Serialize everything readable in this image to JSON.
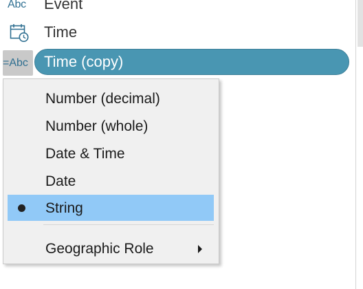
{
  "fields": [
    {
      "icon": "string-type-icon",
      "icon_text": "Abc",
      "label": "Event"
    },
    {
      "icon": "date-time-type-icon",
      "label": "Time"
    },
    {
      "icon": "calculated-string-type-icon",
      "icon_text": "=Abc",
      "label": "Time (copy)",
      "selected": true
    }
  ],
  "menu": {
    "items": [
      {
        "label": "Number (decimal)"
      },
      {
        "label": "Number (whole)"
      },
      {
        "label": "Date & Time"
      },
      {
        "label": "Date"
      },
      {
        "label": "String",
        "checked": true
      },
      {
        "label": "Geographic Role",
        "submenu": true
      }
    ]
  },
  "colors": {
    "pill": "#4996b2",
    "icon": "#2f6f91",
    "menu_highlight": "#91c9f7",
    "menu_bg": "#f0f0f0"
  }
}
